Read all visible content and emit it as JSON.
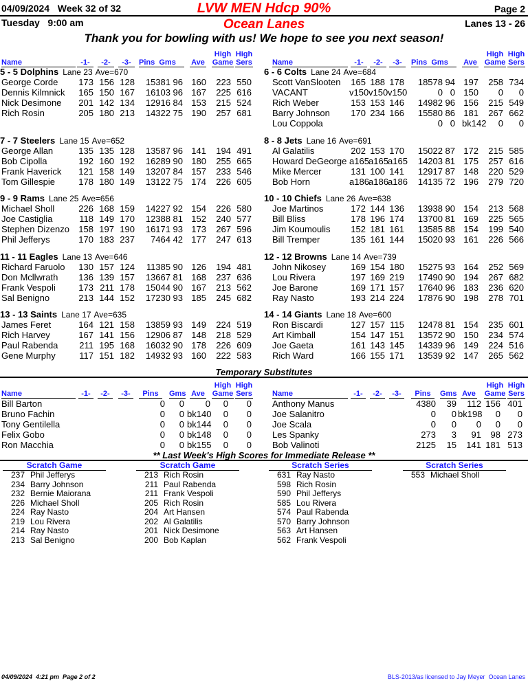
{
  "header": {
    "date": "04/09/2024",
    "week": "Week 32 of 32",
    "title": "LVW MEN Hdcp 90%",
    "page": "Page 2",
    "day_time": "Tuesday   9:00 am",
    "center": "Ocean Lanes",
    "lanes": "Lanes 13 - 26",
    "message": "Thank you for bowling with us! We hope to see you next season!"
  },
  "columns": {
    "name": "Name",
    "g1": "-1-",
    "g2": "-2-",
    "g3": "-3-",
    "pins": "Pins",
    "gms": "Gms",
    "ave": "Ave",
    "high": "High",
    "game": "Game",
    "sers": "Sers"
  },
  "teams_left": [
    {
      "title": "5 - 5 Dolphins",
      "lane": "Lane 23",
      "ave": "Ave=670",
      "players": [
        [
          "George Corde",
          "173",
          "156",
          "128",
          "15381",
          "96",
          "160",
          "223",
          "550"
        ],
        [
          "Dennis Kilmnick",
          "165",
          "150",
          "167",
          "16103",
          "96",
          "167",
          "225",
          "616"
        ],
        [
          "Nick Desimone",
          "201",
          "142",
          "134",
          "12916",
          "84",
          "153",
          "215",
          "524"
        ],
        [
          "Rich Rosin",
          "205",
          "180",
          "213",
          "14322",
          "75",
          "190",
          "257",
          "681"
        ]
      ]
    },
    {
      "title": "7 - 7 Steelers",
      "lane": "Lane 15",
      "ave": "Ave=652",
      "players": [
        [
          "George Allan",
          "135",
          "135",
          "128",
          "13587",
          "96",
          "141",
          "194",
          "491"
        ],
        [
          "Bob Cipolla",
          "192",
          "160",
          "192",
          "16289",
          "90",
          "180",
          "255",
          "665"
        ],
        [
          "Frank Haverick",
          "121",
          "158",
          "149",
          "13207",
          "84",
          "157",
          "233",
          "546"
        ],
        [
          "Tom Gillespie",
          "178",
          "180",
          "149",
          "13122",
          "75",
          "174",
          "226",
          "605"
        ]
      ]
    },
    {
      "title": "9 - 9 Rams",
      "lane": "Lane 25",
      "ave": "Ave=656",
      "players": [
        [
          "Michael Sholl",
          "226",
          "168",
          "159",
          "14227",
          "92",
          "154",
          "226",
          "580"
        ],
        [
          "Joe Castiglia",
          "118",
          "149",
          "170",
          "12388",
          "81",
          "152",
          "240",
          "577"
        ],
        [
          "Stephen Dizenzo",
          "158",
          "197",
          "190",
          "16171",
          "93",
          "173",
          "267",
          "596"
        ],
        [
          "Phil Jefferys",
          "170",
          "183",
          "237",
          "7464",
          "42",
          "177",
          "247",
          "613"
        ]
      ]
    },
    {
      "title": "11 - 11 Eagles",
      "lane": "Lane 13",
      "ave": "Ave=646",
      "players": [
        [
          "Richard Faruolo",
          "130",
          "157",
          "124",
          "11385",
          "90",
          "126",
          "194",
          "481"
        ],
        [
          "Don Mcllwrath",
          "136",
          "139",
          "157",
          "13667",
          "81",
          "168",
          "237",
          "636"
        ],
        [
          "Frank Vespoli",
          "173",
          "211",
          "178",
          "15044",
          "90",
          "167",
          "213",
          "562"
        ],
        [
          "Sal Benigno",
          "213",
          "144",
          "152",
          "17230",
          "93",
          "185",
          "245",
          "682"
        ]
      ]
    },
    {
      "title": "13 - 13 Saints",
      "lane": "Lane 17",
      "ave": "Ave=635",
      "players": [
        [
          "James Feret",
          "164",
          "121",
          "158",
          "13859",
          "93",
          "149",
          "224",
          "519"
        ],
        [
          "Rich Harvey",
          "167",
          "141",
          "156",
          "12906",
          "87",
          "148",
          "218",
          "529"
        ],
        [
          "Paul Rabenda",
          "211",
          "195",
          "168",
          "16032",
          "90",
          "178",
          "226",
          "609"
        ],
        [
          "Gene Murphy",
          "117",
          "151",
          "182",
          "14932",
          "93",
          "160",
          "222",
          "583"
        ]
      ]
    }
  ],
  "teams_right": [
    {
      "title": "6 - 6 Colts",
      "lane": "Lane 24",
      "ave": "Ave=684",
      "players": [
        [
          "Scott VanSlooten",
          "165",
          "188",
          "178",
          "18578",
          "94",
          "197",
          "258",
          "734"
        ],
        [
          "VACANT",
          "v150",
          "v150",
          "v150",
          "0",
          "0",
          "150",
          "0",
          "0"
        ],
        [
          "Rich Weber",
          "153",
          "153",
          "146",
          "14982",
          "96",
          "156",
          "215",
          "549"
        ],
        [
          "Barry Johnson",
          "170",
          "234",
          "166",
          "15580",
          "86",
          "181",
          "267",
          "662"
        ],
        [
          "Lou Coppola",
          "",
          "",
          "",
          "0",
          "0",
          "bk142",
          "0",
          "0"
        ]
      ]
    },
    {
      "title": "8 - 8 Jets",
      "lane": "Lane 16",
      "ave": "Ave=691",
      "players": [
        [
          "Al Galatilis",
          "202",
          "153",
          "170",
          "15022",
          "87",
          "172",
          "215",
          "585"
        ],
        [
          "Howard DeGeorge",
          "a165",
          "a165",
          "a165",
          "14203",
          "81",
          "175",
          "257",
          "616"
        ],
        [
          "Mike Mercer",
          "131",
          "100",
          "141",
          "12917",
          "87",
          "148",
          "220",
          "529"
        ],
        [
          "Bob Horn",
          "a186",
          "a186",
          "a186",
          "14135",
          "72",
          "196",
          "279",
          "720"
        ]
      ]
    },
    {
      "title": "10 - 10 Chiefs",
      "lane": "Lane 26",
      "ave": "Ave=638",
      "players": [
        [
          "Joe Martinos",
          "172",
          "144",
          "136",
          "13938",
          "90",
          "154",
          "213",
          "568"
        ],
        [
          "Bill Bliss",
          "178",
          "196",
          "174",
          "13700",
          "81",
          "169",
          "225",
          "565"
        ],
        [
          "Jim Koumoulis",
          "152",
          "181",
          "161",
          "13585",
          "88",
          "154",
          "199",
          "540"
        ],
        [
          "Bill Tremper",
          "135",
          "161",
          "144",
          "15020",
          "93",
          "161",
          "226",
          "566"
        ]
      ]
    },
    {
      "title": "12 - 12 Browns",
      "lane": "Lane 14",
      "ave": "Ave=739",
      "players": [
        [
          "John Nikosey",
          "169",
          "154",
          "180",
          "15275",
          "93",
          "164",
          "252",
          "569"
        ],
        [
          "Lou Rivera",
          "197",
          "169",
          "219",
          "17490",
          "90",
          "194",
          "267",
          "682"
        ],
        [
          "Joe Barone",
          "169",
          "171",
          "157",
          "17640",
          "96",
          "183",
          "236",
          "620"
        ],
        [
          "Ray Nasto",
          "193",
          "214",
          "224",
          "17876",
          "90",
          "198",
          "278",
          "701"
        ]
      ]
    },
    {
      "title": "14 - 14 Giants",
      "lane": "Lane 18",
      "ave": "Ave=600",
      "players": [
        [
          "Ron Biscardi",
          "127",
          "157",
          "115",
          "12478",
          "81",
          "154",
          "235",
          "601"
        ],
        [
          "Art Kimball",
          "154",
          "147",
          "151",
          "13572",
          "90",
          "150",
          "234",
          "574"
        ],
        [
          "Joe Gaeta",
          "161",
          "143",
          "145",
          "14339",
          "96",
          "149",
          "224",
          "516"
        ],
        [
          "Rich Ward",
          "166",
          "155",
          "171",
          "13539",
          "92",
          "147",
          "265",
          "562"
        ]
      ]
    }
  ],
  "substitutes": {
    "title": "Temporary Substitutes",
    "left": [
      [
        "Bill Barton",
        "",
        "",
        "",
        "0",
        "0",
        "0",
        "0",
        "0"
      ],
      [
        "Bruno Fachin",
        "",
        "",
        "",
        "0",
        "0",
        "bk140",
        "0",
        "0"
      ],
      [
        "Tony Gentilella",
        "",
        "",
        "",
        "0",
        "0",
        "bk144",
        "0",
        "0"
      ],
      [
        "Felix Gobo",
        "",
        "",
        "",
        "0",
        "0",
        "bk148",
        "0",
        "0"
      ],
      [
        "Ron Macchia",
        "",
        "",
        "",
        "0",
        "0",
        "bk155",
        "0",
        "0"
      ]
    ],
    "right": [
      [
        "Anthony Manus",
        "",
        "",
        "",
        "4380",
        "39",
        "112",
        "156",
        "401"
      ],
      [
        "Joe Salanitro",
        "",
        "",
        "",
        "0",
        "0",
        "bk198",
        "0",
        "0"
      ],
      [
        "Joe Scala",
        "",
        "",
        "",
        "0",
        "0",
        "0",
        "0",
        "0"
      ],
      [
        "Les Spanky",
        "",
        "",
        "",
        "273",
        "3",
        "91",
        "98",
        "273"
      ],
      [
        "Bob Valinoti",
        "",
        "",
        "",
        "2125",
        "15",
        "141",
        "181",
        "513"
      ]
    ]
  },
  "high_scores": {
    "title": "** Last Week's High Scores for Immediate Release **",
    "columns": [
      {
        "heading": "Scratch Game",
        "entries": [
          [
            "237",
            "Phil Jefferys"
          ],
          [
            "234",
            "Barry Johnson"
          ],
          [
            "232",
            "Bernie Maiorana"
          ],
          [
            "226",
            "Michael Sholl"
          ],
          [
            "224",
            "Ray Nasto"
          ],
          [
            "219",
            "Lou Rivera"
          ],
          [
            "214",
            "Ray Nasto"
          ],
          [
            "213",
            "Sal Benigno"
          ]
        ]
      },
      {
        "heading": "Scratch Game",
        "entries": [
          [
            "213",
            "Rich Rosin"
          ],
          [
            "211",
            "Paul Rabenda"
          ],
          [
            "211",
            "Frank Vespoli"
          ],
          [
            "205",
            "Rich Rosin"
          ],
          [
            "204",
            "Art Hansen"
          ],
          [
            "202",
            "Al Galatilis"
          ],
          [
            "201",
            "Nick Desimone"
          ],
          [
            "200",
            "Bob Kaplan"
          ]
        ]
      },
      {
        "heading": "Scratch Series",
        "entries": [
          [
            "631",
            "Ray Nasto"
          ],
          [
            "598",
            "Rich Rosin"
          ],
          [
            "590",
            "Phil Jefferys"
          ],
          [
            "585",
            "Lou Rivera"
          ],
          [
            "574",
            "Paul Rabenda"
          ],
          [
            "570",
            "Barry Johnson"
          ],
          [
            "563",
            "Art Hansen"
          ],
          [
            "562",
            "Frank Vespoli"
          ]
        ]
      },
      {
        "heading": "Scratch Series",
        "entries": [
          [
            "553",
            "Michael Sholl"
          ]
        ]
      }
    ]
  },
  "footer": {
    "left": "04/09/2024  4:21 pm  Page 2 of 2",
    "right": "BLS-2013/as licensed to Jay Meyer  Ocean Lanes"
  }
}
